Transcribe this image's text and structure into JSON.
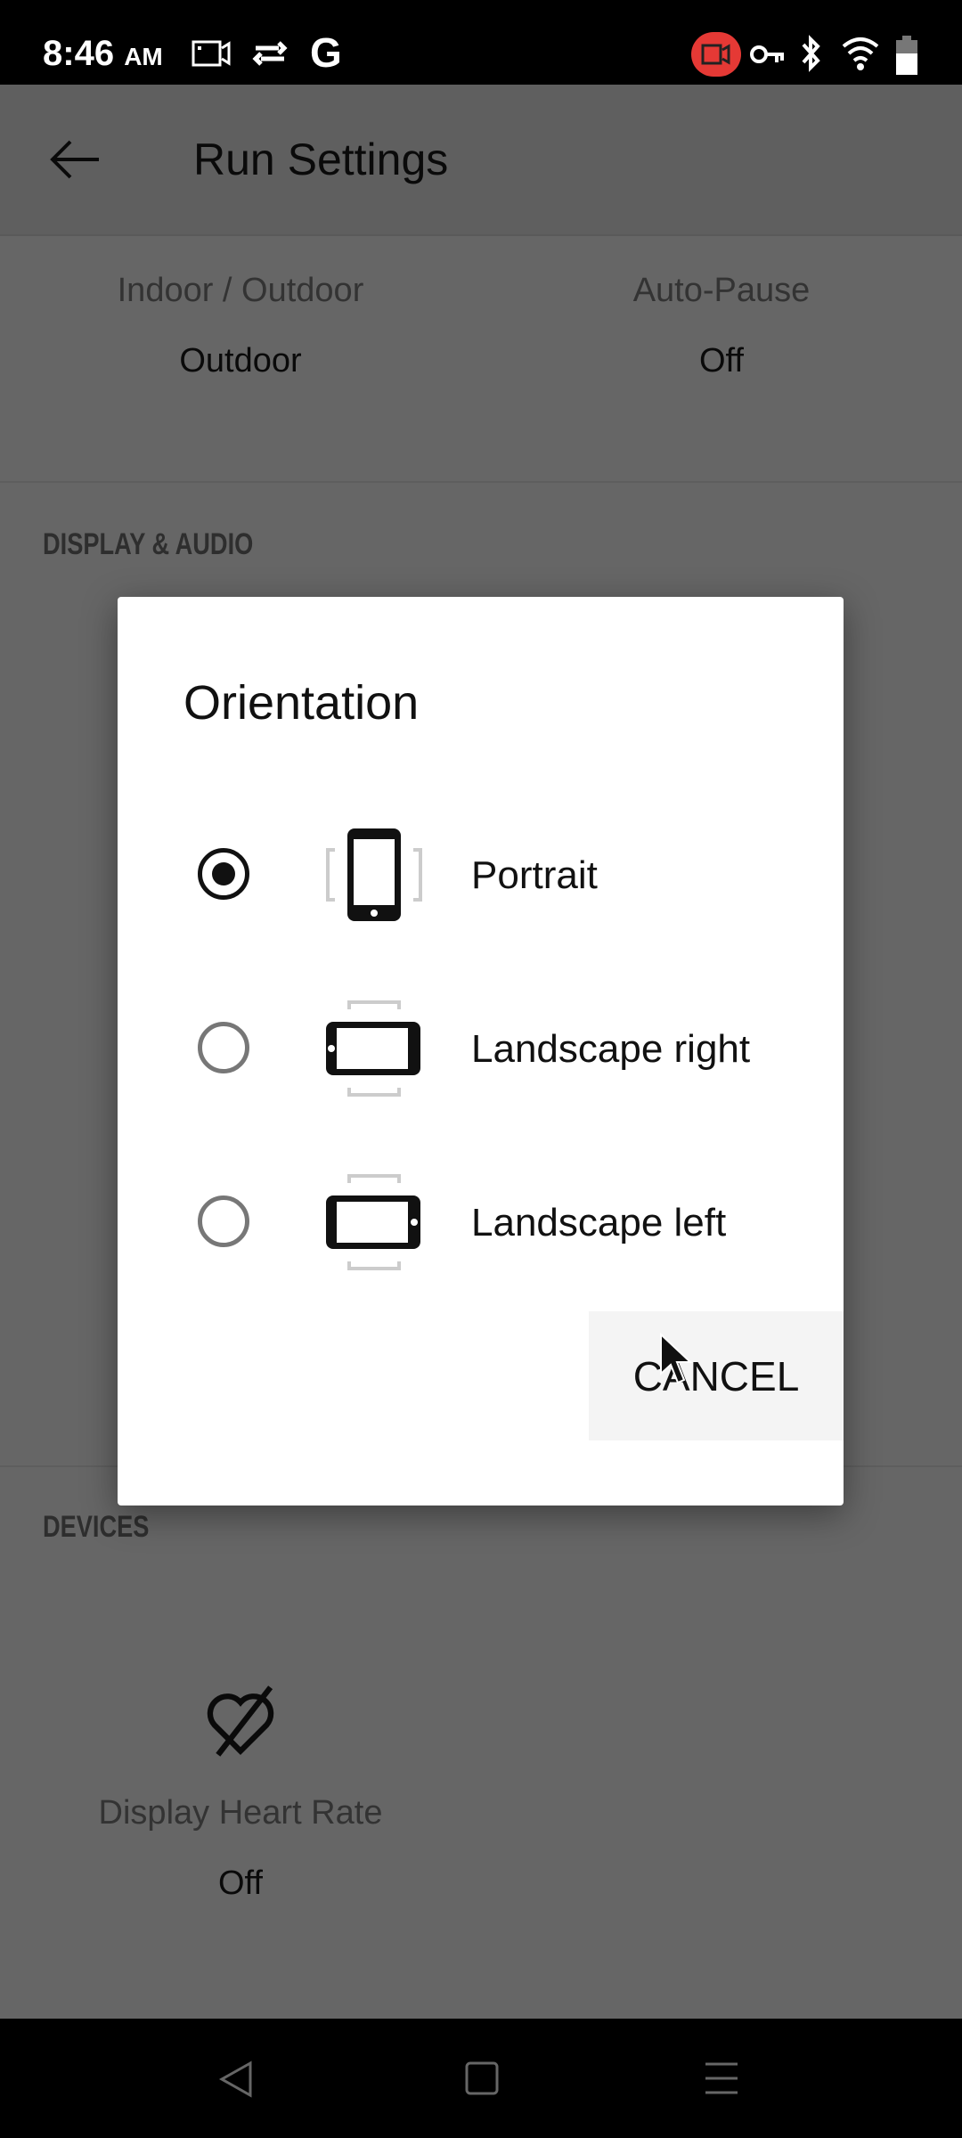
{
  "status_bar": {
    "time": "8:46",
    "ampm": "AM",
    "icons": [
      "screen-record-icon",
      "sync-icon",
      "google-icon",
      "recording-badge-icon",
      "vpn-key-icon",
      "bluetooth-icon",
      "wifi-icon",
      "battery-icon"
    ],
    "record_color": "#e53935"
  },
  "app_bar": {
    "title": "Run Settings",
    "back_icon": "arrow-left-icon"
  },
  "settings": [
    {
      "label": "Indoor / Outdoor",
      "value": "Outdoor"
    },
    {
      "label": "Auto-Pause",
      "value": "Off"
    }
  ],
  "sections": {
    "display_audio": "DISPLAY & AUDIO",
    "devices": "DEVICES"
  },
  "devices": {
    "heart_rate": {
      "label": "Display Heart Rate",
      "value": "Off",
      "icon": "heart-rate-off-icon"
    }
  },
  "dialog": {
    "title": "Orientation",
    "options": [
      {
        "label": "Portrait",
        "selected": true,
        "icon": "phone-portrait-icon"
      },
      {
        "label": "Landscape right",
        "selected": false,
        "icon": "phone-landscape-right-icon"
      },
      {
        "label": "Landscape left",
        "selected": false,
        "icon": "phone-landscape-left-icon"
      }
    ],
    "cancel": "CANCEL"
  },
  "nav_bar": [
    "back-icon",
    "home-icon",
    "menu-icon"
  ]
}
